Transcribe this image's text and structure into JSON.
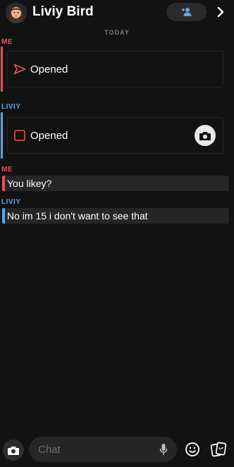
{
  "header": {
    "title": "Liviy Bird",
    "avatar_icon": "bitmoji-avatar",
    "call_icon": "add-friend-icon",
    "chevron_icon": "chevron-right-icon"
  },
  "divider": {
    "label": "TODAY"
  },
  "messages": [
    {
      "sender": "ME",
      "kind": "snap",
      "status": "Opened",
      "icon": "sent-arrow-icon",
      "color": "#e2545f"
    },
    {
      "sender": "LIVIY",
      "kind": "snap",
      "status": "Opened",
      "icon": "received-square-icon",
      "color": "#5aa5ea",
      "reply_icon": "camera-reply-icon"
    },
    {
      "sender": "ME",
      "kind": "text",
      "text": "You likey?",
      "color": "#e2545f"
    },
    {
      "sender": "LIVIY",
      "kind": "text",
      "text": "No im 15 i don't want to see that",
      "color": "#5aa5ea"
    }
  ],
  "composer": {
    "placeholder": "Chat",
    "camera_icon": "camera-icon",
    "mic_icon": "microphone-icon",
    "emoji_icon": "smiley-icon",
    "sticker_icon": "sticker-icon"
  },
  "colors": {
    "me": "#e2545f",
    "them": "#5aa5ea",
    "background": "#121212"
  }
}
